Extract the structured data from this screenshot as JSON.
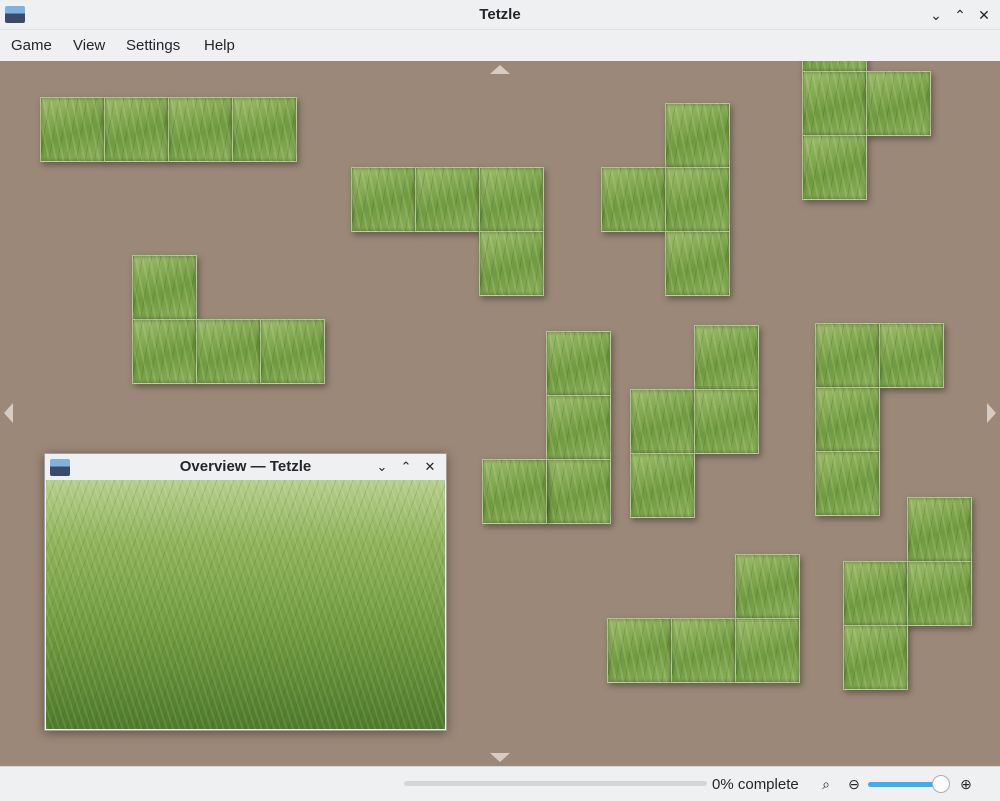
{
  "window": {
    "title": "Tetzle"
  },
  "menu": [
    "Game",
    "View",
    "Settings",
    "Help"
  ],
  "overview": {
    "title": "Overview — Tetzle"
  },
  "status": {
    "progress_text": "0% complete",
    "progress_fraction": 0.0,
    "zoom_level_fraction": 0.9
  },
  "colors": {
    "board": "#9c8878",
    "accent": "#3daee9"
  },
  "icons": {
    "minimize": "chevron-down-icon",
    "maximize": "chevron-up-icon",
    "close": "close-icon",
    "zoom_fit": "zoom-fit-icon",
    "zoom_out": "zoom-out-icon",
    "zoom_in": "zoom-in-icon"
  }
}
